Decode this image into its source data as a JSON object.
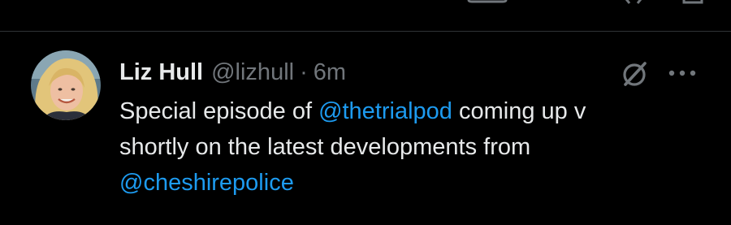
{
  "tweet": {
    "author_name": "Liz Hull",
    "handle": "@lizhull",
    "separator": "·",
    "time": "6m",
    "body": {
      "line1_pre": "Special episode of ",
      "mention1": "@thetrialpod",
      "line1_post": " coming up v",
      "line2": "shortly on the latest developments from",
      "mention2": "@cheshirepolice"
    }
  },
  "colors": {
    "background": "#000000",
    "text": "#e7e9ea",
    "secondary": "#71767b",
    "link": "#1d9bf0",
    "divider": "#2f3336"
  },
  "icons": {
    "grok": "grok-slash-icon",
    "more": "more-dots-icon"
  }
}
